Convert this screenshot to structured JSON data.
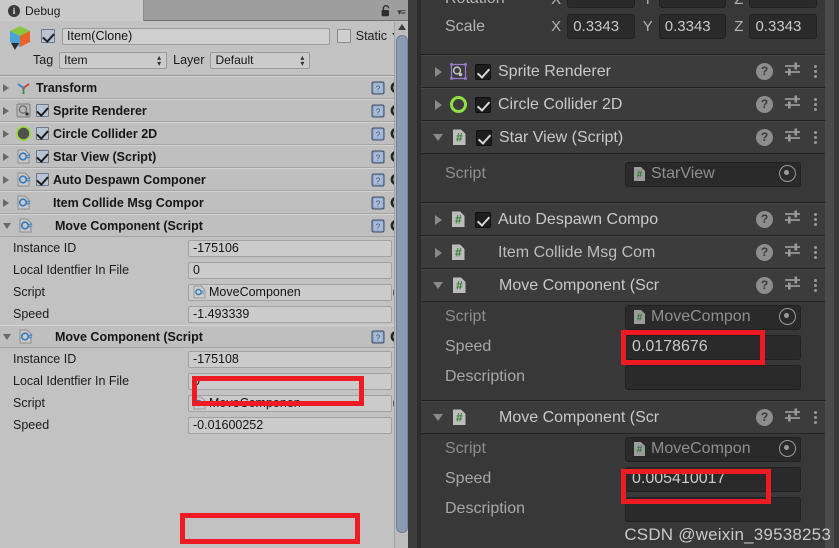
{
  "left_panel": {
    "tab": {
      "label": "Debug",
      "icon": "info-icon"
    },
    "gameobject": {
      "name": "Item(Clone)",
      "enabled": true,
      "static_label": "Static",
      "static_checked": false,
      "tag_label": "Tag",
      "tag_value": "Item",
      "layer_label": "Layer",
      "layer_value": "Default"
    },
    "components": [
      {
        "name": "Transform",
        "icon": "transform-icon",
        "expanded": false,
        "has_toggle": false,
        "enabled": false
      },
      {
        "name": "Sprite Renderer",
        "icon": "sprite-renderer-icon",
        "expanded": false,
        "has_toggle": true,
        "enabled": true
      },
      {
        "name": "Circle Collider 2D",
        "icon": "circle-collider-icon",
        "expanded": false,
        "has_toggle": true,
        "enabled": true
      },
      {
        "name": "Star View (Script)",
        "icon": "csharp-script-icon",
        "expanded": false,
        "has_toggle": true,
        "enabled": true
      },
      {
        "name": "Auto Despawn Componer",
        "icon": "csharp-script-icon",
        "expanded": false,
        "has_toggle": true,
        "enabled": true
      },
      {
        "name": "Item Collide Msg Compor",
        "icon": "csharp-script-icon",
        "expanded": false,
        "has_toggle": false,
        "enabled": false
      }
    ],
    "move_component_1": {
      "header": "Move Component (Script",
      "icon": "csharp-script-icon",
      "rows": [
        {
          "label": "Instance ID",
          "value": "-175106"
        },
        {
          "label": "Local Identfier In File",
          "value": "0"
        },
        {
          "label": "Script",
          "value": "MoveComponen",
          "type": "object"
        },
        {
          "label": "Speed",
          "value": "-1.493339",
          "highlighted": true
        }
      ]
    },
    "move_component_2": {
      "header": "Move Component (Script",
      "icon": "csharp-script-icon",
      "rows": [
        {
          "label": "Instance ID",
          "value": "-175108"
        },
        {
          "label": "Local Identfier In File",
          "value": "0"
        },
        {
          "label": "Script",
          "value": "MoveComponen",
          "type": "object"
        },
        {
          "label": "Speed",
          "value": "-0.01600252",
          "highlighted": true
        }
      ]
    }
  },
  "right_panel": {
    "transform": {
      "rotation_label": "Rotation",
      "scale_label": "Scale",
      "axes": [
        "X",
        "Y",
        "Z"
      ],
      "scale_values": [
        "0.334",
        "0.334",
        "0.334"
      ],
      "scale_values_clean": [
        "0.3343",
        "0.3343",
        "0.3343"
      ]
    },
    "components": [
      {
        "name": "Sprite Renderer",
        "icon": "sprite-renderer-icon",
        "expanded": false,
        "has_toggle": true,
        "enabled": true
      },
      {
        "name": "Circle Collider 2D",
        "icon": "circle-collider-icon",
        "expanded": false,
        "has_toggle": true,
        "enabled": true
      }
    ],
    "star_view": {
      "header": "Star View (Script)",
      "icon": "csharp-script-icon",
      "expanded": true,
      "enabled": true,
      "script_label": "Script",
      "script_value": "StarView"
    },
    "auto_despawn": {
      "name": "Auto Despawn Compo",
      "icon": "csharp-script-icon",
      "expanded": false,
      "has_toggle": true,
      "enabled": true
    },
    "item_collide": {
      "name": "Item Collide Msg Com",
      "icon": "csharp-script-icon",
      "expanded": false,
      "has_toggle": false,
      "enabled": false
    },
    "move_component_1": {
      "header": "Move Component (Scr",
      "icon": "csharp-script-icon",
      "script_label": "Script",
      "script_value": "MoveCompon",
      "speed_label": "Speed",
      "speed_value": "0.0178676",
      "description_label": "Description",
      "description_value": ""
    },
    "move_component_2": {
      "header": "Move Component (Scr",
      "icon": "csharp-script-icon",
      "script_label": "Script",
      "script_value": "MoveCompon",
      "speed_label": "Speed",
      "speed_value": "0.005410017",
      "description_label": "Description",
      "description_value": ""
    },
    "tools": {
      "help": "?",
      "preset": "preset-icon",
      "menu": "kebab-menu-icon"
    }
  },
  "watermark": "CSDN @weixin_39538253",
  "colors": {
    "highlight": "#ee1b24",
    "light_bg": "#c2c2c2",
    "dark_bg": "#383838",
    "dark_header": "#3c3c3c",
    "collider_green": "#8fe044"
  }
}
